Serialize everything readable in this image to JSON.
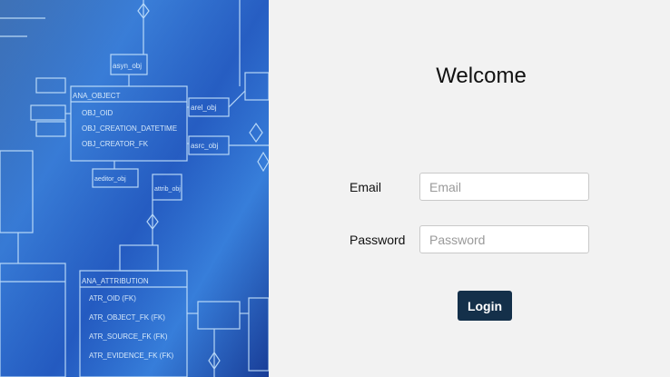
{
  "hero": {
    "image": "database-schema-diagram",
    "table_headers": [
      "ANA_OBJECT",
      "ANA_ATTRIBUTION"
    ],
    "object_fields": [
      "OBJ_OID",
      "OBJ_CREATION_DATETIME",
      "OBJ_CREATOR_FK"
    ],
    "attribution_fields": [
      "ATR_OID (FK)",
      "ATR_OBJECT_FK (FK)",
      "ATR_SOURCE_FK (FK)",
      "ATR_EVIDENCE_FK (FK)"
    ],
    "relation_labels": [
      "asyn_obj",
      "asrc_obj",
      "arel_obj",
      "aeditor_obj",
      "attrib_obj"
    ]
  },
  "form": {
    "title": "Welcome",
    "email_label": "Email",
    "email_placeholder": "Email",
    "email_value": "",
    "password_label": "Password",
    "password_placeholder": "Password",
    "password_value": "",
    "login_label": "Login"
  },
  "colors": {
    "background": "#f2f2f2",
    "button": "#14304a",
    "button_text": "#ffffff"
  }
}
